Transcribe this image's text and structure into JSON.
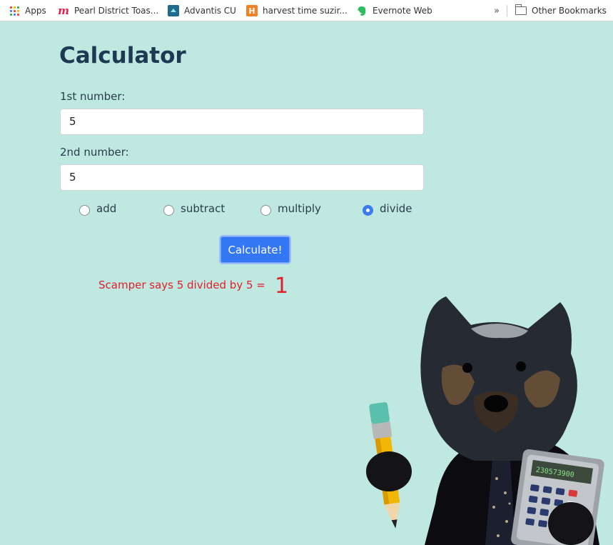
{
  "bookmarks": {
    "items": [
      {
        "label": "Apps",
        "icon": "apps-grid-icon"
      },
      {
        "label": "Pearl District Toas...",
        "icon": "meetup-icon"
      },
      {
        "label": "Advantis CU",
        "icon": "advantis-icon"
      },
      {
        "label": "harvest time suzir...",
        "icon": "harvest-icon"
      },
      {
        "label": "Evernote Web",
        "icon": "evernote-icon"
      }
    ],
    "overflow": "»",
    "other": {
      "label": "Other Bookmarks",
      "icon": "folder-icon"
    }
  },
  "page": {
    "title": "Calculator",
    "first_label": "1st number:",
    "first_value": "5",
    "second_label": "2nd number:",
    "second_value": "5",
    "operations": [
      {
        "label": "add",
        "checked": false
      },
      {
        "label": "subtract",
        "checked": false
      },
      {
        "label": "multiply",
        "checked": false
      },
      {
        "label": "divide",
        "checked": true
      }
    ],
    "button_label": "Calculate!",
    "result_text": "Scamper says 5 divided by 5 =",
    "result_value": "1"
  },
  "mascot": {
    "calculator_display": "230573900"
  },
  "colors": {
    "background": "#bee8e0",
    "title": "#1e3a52",
    "button": "#3477f5",
    "result": "#e0202a"
  }
}
